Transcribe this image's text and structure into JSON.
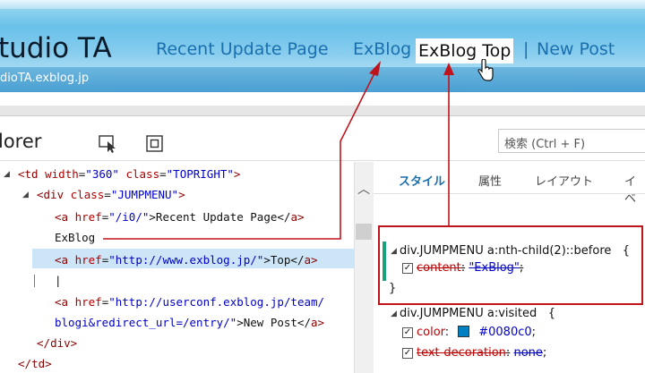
{
  "blog": {
    "title": "tudio TA",
    "url": "dioTA.exblog.jp",
    "nav": {
      "recent": "Recent Update Page",
      "exblog": "ExBlog",
      "exblog_top": "ExBlog Top",
      "separator": "|",
      "new_post": "New Post"
    }
  },
  "devtools": {
    "panel_title": "lorer",
    "search_placeholder": "検索 (Ctrl + F)",
    "tabs": {
      "styles": "スタイル",
      "attributes": "属性",
      "layout": "レイアウト",
      "events": "イベ"
    },
    "dom": {
      "l1": {
        "open": "<",
        "tag": "td",
        "a1n": "width",
        "a1v": "\"360\"",
        "a2n": "class",
        "a2v": "\"TOPRIGHT\"",
        "close": ">"
      },
      "l2": {
        "open": "<",
        "tag": "div",
        "a1n": "class",
        "a1v": "\"JUMPMENU\"",
        "close": ">"
      },
      "l3": {
        "open": "<",
        "tag": "a",
        "a1n": "href",
        "a1v": "\"/i0/\"",
        "text": ">Recent Update Page</",
        "tag2": "a",
        "close": ">"
      },
      "l4": {
        "text": "ExBlog"
      },
      "l5": {
        "open": "<",
        "tag": "a",
        "a1n": "href",
        "a1v": "\"http://www.exblog.jp/\"",
        "text": ">Top</",
        "tag2": "a",
        "close": ">"
      },
      "l6": {
        "text": "|"
      },
      "l7": {
        "open": "<",
        "tag": "a",
        "a1n": "href",
        "a1v": "\"http://userconf.exblog.jp/team/"
      },
      "l8": {
        "a1v": "blogi&redirect_url=/entry/\"",
        "text": ">New Post</",
        "tag2": "a",
        "close": ">"
      },
      "l9": {
        "open": "</",
        "tag": "div",
        "close": ">"
      },
      "l10": {
        "open": "</",
        "tag": "td",
        "close": ">"
      }
    },
    "styles": {
      "rule1_selector": "div.JUMPMENU a:nth-child(2)::before",
      "rule1_open": "{",
      "rule1_prop": "content",
      "rule1_colon": ":",
      "rule1_value": "\"ExBlog\"",
      "rule1_semi": ";",
      "rule1_close": "}",
      "rule2_selector": "div.JUMPMENU a:visited",
      "rule2_open": "{",
      "rule2_prop1": "color",
      "rule2_val1": "#0080c0",
      "rule2_prop2": "text-decoration",
      "rule2_val2": "none",
      "colon": ":",
      "semi": ";",
      "check": "✓"
    }
  },
  "colors": {
    "accent_link": "#1a6fae",
    "annotation_red": "#c0141c",
    "swatch": "#0080c0"
  }
}
